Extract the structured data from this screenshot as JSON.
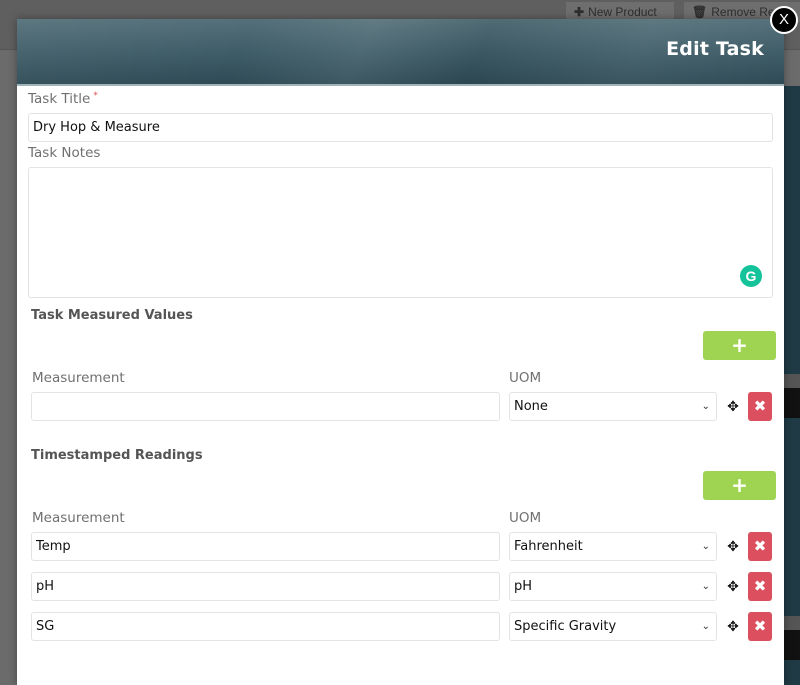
{
  "background": {
    "toolbar": {
      "new_product_icon": "plus-icon",
      "new_product_label": "New Product",
      "remove_icon": "trash-icon",
      "remove_label": "Remove Re"
    }
  },
  "modal": {
    "title": "Edit Task",
    "close_label": "X",
    "task_title": {
      "label": "Task Title",
      "required_mark": "*",
      "value": "Dry Hop & Measure"
    },
    "task_notes": {
      "label": "Task Notes",
      "value": "",
      "grammarly_glyph": "G"
    },
    "measured_values": {
      "title": "Task Measured Values",
      "add_label": "+",
      "measurement_header": "Measurement",
      "uom_header": "UOM",
      "rows": [
        {
          "measurement": "",
          "uom": "None"
        }
      ]
    },
    "timestamped_readings": {
      "title": "Timestamped Readings",
      "add_label": "+",
      "measurement_header": "Measurement",
      "uom_header": "UOM",
      "rows": [
        {
          "measurement": "Temp",
          "uom": "Fahrenheit"
        },
        {
          "measurement": "pH",
          "uom": "pH"
        },
        {
          "measurement": "SG",
          "uom": "Specific Gravity"
        }
      ]
    },
    "icons": {
      "move_glyph": "✥",
      "delete_glyph": "✖",
      "chevron_glyph": "⌄"
    }
  },
  "colors": {
    "add_green": "#9fd453",
    "delete_red": "#dc4f5f",
    "header_teal": "#3f5d68",
    "grammarly_green": "#15c39a"
  }
}
